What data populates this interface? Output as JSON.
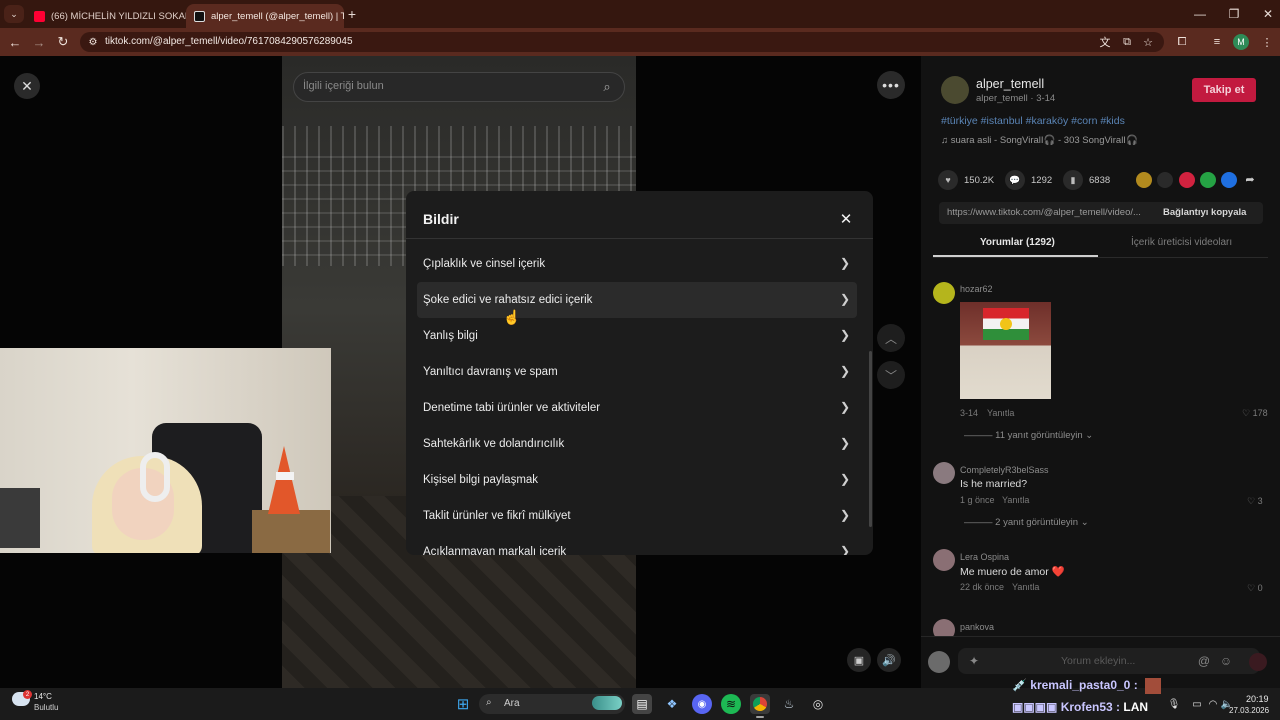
{
  "browser": {
    "tabs": [
      {
        "label": "(66) MİCHELİN YILDIZLI SOKAK",
        "favicon_color": "#ff0033",
        "active": false
      },
      {
        "label": "alper_temell (@alper_temell) | T",
        "favicon_color": "#111111",
        "active": true
      }
    ],
    "url": "tiktok.com/@alper_temell/video/7617084290576289045"
  },
  "page": {
    "search_placeholder": "İlgili içeriği bulun"
  },
  "modal": {
    "title": "Bildir",
    "items": [
      "Çıplaklık ve cinsel içerik",
      "Şoke edici ve rahatsız edici içerik",
      "Yanlış bilgi",
      "Yanıltıcı davranış ve spam",
      "Denetime tabi ürünler ve aktiviteler",
      "Sahtekârlık ve dolandırıcılık",
      "Kişisel bilgi paylaşmak",
      "Taklit ürünler ve fikrî mülkiyet",
      "Açıklanmayan markalı içerik"
    ],
    "hovered_index": 1
  },
  "panel": {
    "username": "alper_temell",
    "meta": "alper_temell · 3-14",
    "follow_label": "Takip et",
    "hashtags": "#türkiye #istanbul #karaköy #corn #kids",
    "music": "♫ suara asli - SongViralI🎧 - 303 SongViralI🎧",
    "likes": "150.2K",
    "comments": "1292",
    "saves": "6838",
    "link": "https://www.tiktok.com/@alper_temell/video/...",
    "copy_link_label": "Bağlantıyı kopyala",
    "tab_comments": "Yorumlar (1292)",
    "tab_creator_videos": "İçerik üreticisi videoları",
    "comment_placeholder": "Yorum ekleyin...",
    "comments_list": [
      {
        "name": "hozar62",
        "text": "",
        "meta": "3-14",
        "reply": "Yanıtla",
        "likes": "178",
        "replies": "11 yanıt görüntüleyin"
      },
      {
        "name": "CompletelyR3belSass",
        "text": "Is he married?",
        "meta": "1 g önce",
        "reply": "Yanıtla",
        "likes": "3",
        "replies": "2 yanıt görüntüleyin"
      },
      {
        "name": "Lera Ospina",
        "text": "Me muero de amor ❤️",
        "meta": "22 dk önce",
        "reply": "Yanıtla",
        "likes": "0",
        "replies": ""
      },
      {
        "name": "pankova",
        "text": "",
        "meta": "",
        "reply": "",
        "likes": "",
        "replies": ""
      }
    ]
  },
  "taskbar": {
    "temperature": "14°C",
    "weather": "Bulutlu",
    "weather_badge": "2",
    "search_label": "Ara",
    "time": "20:19",
    "date": "27.03.2026",
    "chat_user1": "kremali_pasta0_0 :",
    "chat_user2": "Krofen53 :",
    "chat_msg2": "LAN"
  },
  "colors": {
    "tabbar": "#35170f",
    "toolbar": "#5a2a1f",
    "follow_button": "#c21a3f",
    "hashtag": "#5a84b5"
  }
}
